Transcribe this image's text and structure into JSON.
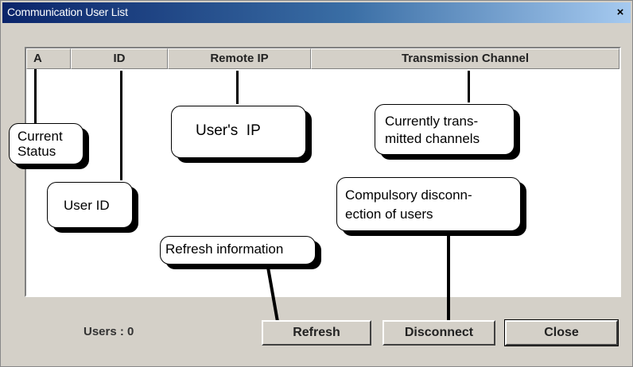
{
  "window": {
    "title": "Communication User List",
    "close_glyph": "×"
  },
  "list": {
    "columns": [
      "A",
      "ID",
      "Remote IP",
      "Transmission Channel"
    ]
  },
  "callouts": {
    "current_status": "Current\nStatus",
    "user_id": "User ID",
    "users_ip": "User's  IP",
    "channels": "Currently trans-\nmitted channels",
    "disconnect": "Compulsory disconn-\nection of users",
    "refresh": "Refresh information"
  },
  "footer": {
    "users_label": "Users :   0"
  },
  "buttons": {
    "refresh": "Refresh",
    "disconnect": "Disconnect",
    "close": "Close"
  }
}
